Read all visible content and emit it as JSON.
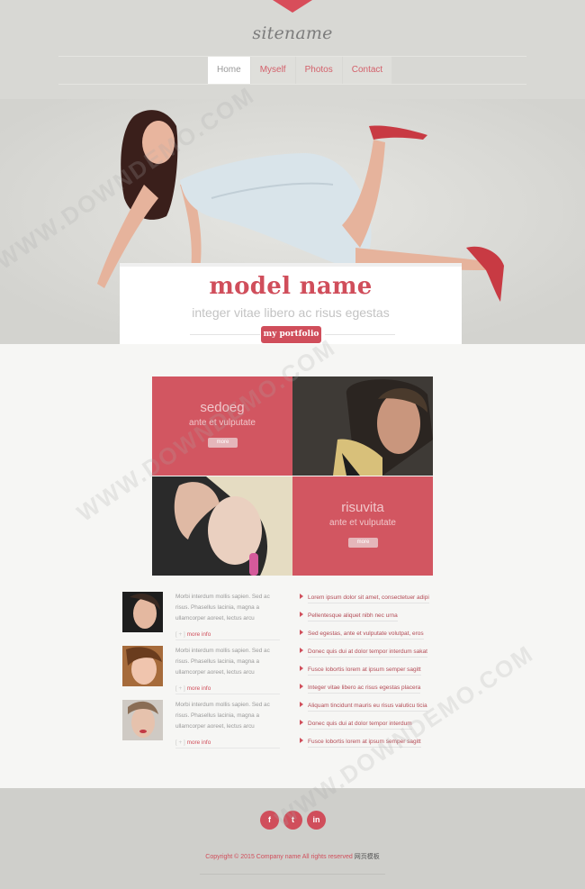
{
  "site": {
    "name": "sitename"
  },
  "nav": {
    "items": [
      {
        "label": "Home",
        "active": true
      },
      {
        "label": "Myself",
        "active": false
      },
      {
        "label": "Photos",
        "active": false
      },
      {
        "label": "Contact",
        "active": false
      }
    ]
  },
  "hero": {
    "title": "model name",
    "subtitle": "integer vitae libero ac risus egestas",
    "button": "my portfolio"
  },
  "tiles": [
    {
      "title": "sedoeg",
      "subtitle": "ante et vulputate",
      "button": "more"
    },
    {
      "title": "risuvita",
      "subtitle": "ante et vulputate",
      "button": "more"
    }
  ],
  "posts": [
    {
      "text": "Morbi interdum mollis sapien. Sed ac risus. Phasellus lacinia, magna a ullamcorper aoreet, lectus arcu",
      "more": "more info",
      "more_bracket": "[ + ]"
    },
    {
      "text": "Morbi interdum mollis sapien. Sed ac risus. Phasellus lacinia, magna a ullamcorper aoreet, lectus arcu",
      "more": "more info",
      "more_bracket": "[ + ]"
    },
    {
      "text": "Morbi interdum mollis sapien. Sed ac risus. Phasellus lacinia, magna a ullamcorper aoreet, lectus arcu",
      "more": "more info",
      "more_bracket": "[ + ]"
    }
  ],
  "links": [
    "Lorem ipsum dolor sit amet, consectetuer adipi",
    "Pellentesque aliquet nibh nec urna",
    "Sed egestas, ante et vulputate volutpat, eros",
    "Donec quis dui at dolor tempor interdum sakat",
    "Fusce lobortis lorem at ipsum semper sagitt",
    "Integer vitae libero ac risus egestas placera",
    "Aliquam tincidunt mauris eu risus valuticu ticia",
    "Donec quis dui at dolor tempor interdum",
    "Fusce lobortis lorem at ipsum semper sagitt"
  ],
  "footer": {
    "social": [
      {
        "icon": "facebook-icon",
        "glyph": "f"
      },
      {
        "icon": "twitter-icon",
        "glyph": "t"
      },
      {
        "icon": "linkedin-icon",
        "glyph": "in"
      }
    ],
    "copyright": "Copyright © 2015 Company name All rights reserved",
    "copyright_cn": "网页模板"
  },
  "watermark": "WWW.DOWNDEMO.COM",
  "colors": {
    "accent": "#d04e5b",
    "header_bg": "#d8d8d4",
    "footer_bg": "#cfcfcb",
    "tile_red": "#d25661"
  }
}
